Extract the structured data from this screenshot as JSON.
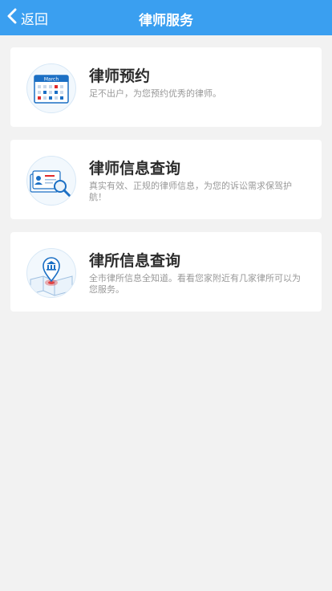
{
  "header": {
    "back_label": "返回",
    "title": "律师服务"
  },
  "colors": {
    "header_bg": "#3a9ff0",
    "page_bg": "#f2f2f2",
    "icon_blue": "#1b6fc4",
    "accent_red": "#e02a2a"
  },
  "cards": [
    {
      "icon": "calendar-icon",
      "icon_text": "March",
      "title": "律师预约",
      "desc": "足不出户，为您预约优秀的律师。"
    },
    {
      "icon": "id-card-search-icon",
      "title": "律师信息查询",
      "desc": "真实有效、正规的律师信息，为您的诉讼需求保驾护航！"
    },
    {
      "icon": "law-firm-map-icon",
      "title": "律所信息查询",
      "desc": "全市律所信息全知道。看看您家附近有几家律所可以为您服务。"
    }
  ]
}
